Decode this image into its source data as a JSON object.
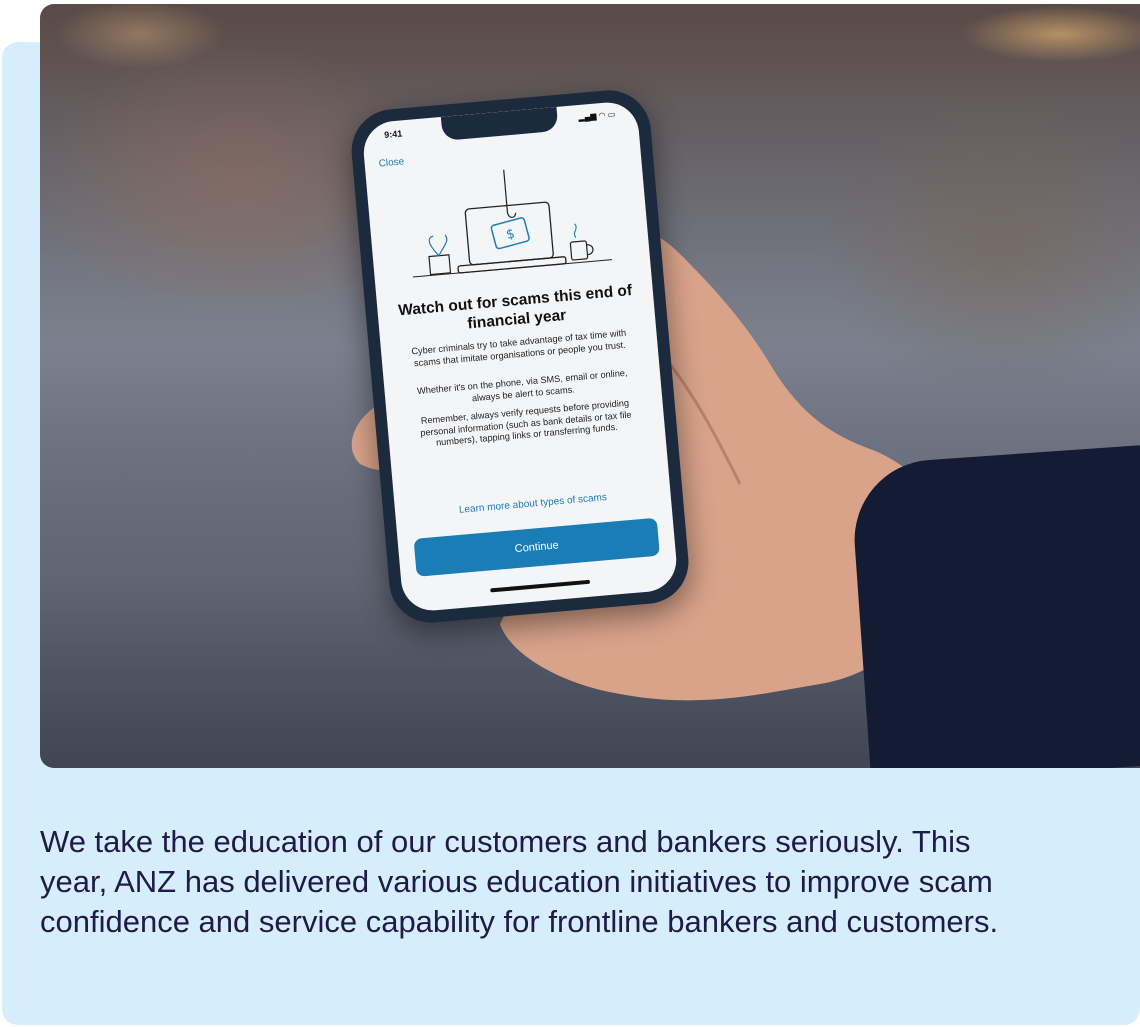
{
  "phone": {
    "time": "9:41",
    "close_label": "Close",
    "title": "Watch out for scams this end of financial year",
    "paragraph1": "Cyber criminals try to take advantage of tax time with scams that imitate organisations or people you trust.",
    "paragraph2": "Whether it's on the phone, via SMS, email or online, always be alert to scams.",
    "paragraph3": "Remember, always verify requests before providing personal information (such as bank details or tax file numbers), tapping links or transferring funds.",
    "learn_more_link": "Learn more about types of scams",
    "continue_button": "Continue",
    "illustration_icon": "laptop-dollar-hook-icon"
  },
  "caption": {
    "text": "We take the education of our customers and bankers seriously. This year, ANZ has delivered various education initiatives to improve scam confidence and service capability for frontline bankers and customers."
  },
  "colors": {
    "card_background": "#d6eefb",
    "caption_text": "#1f1a48",
    "button_blue": "#1a7db6",
    "link_blue": "#1b7bb3"
  }
}
